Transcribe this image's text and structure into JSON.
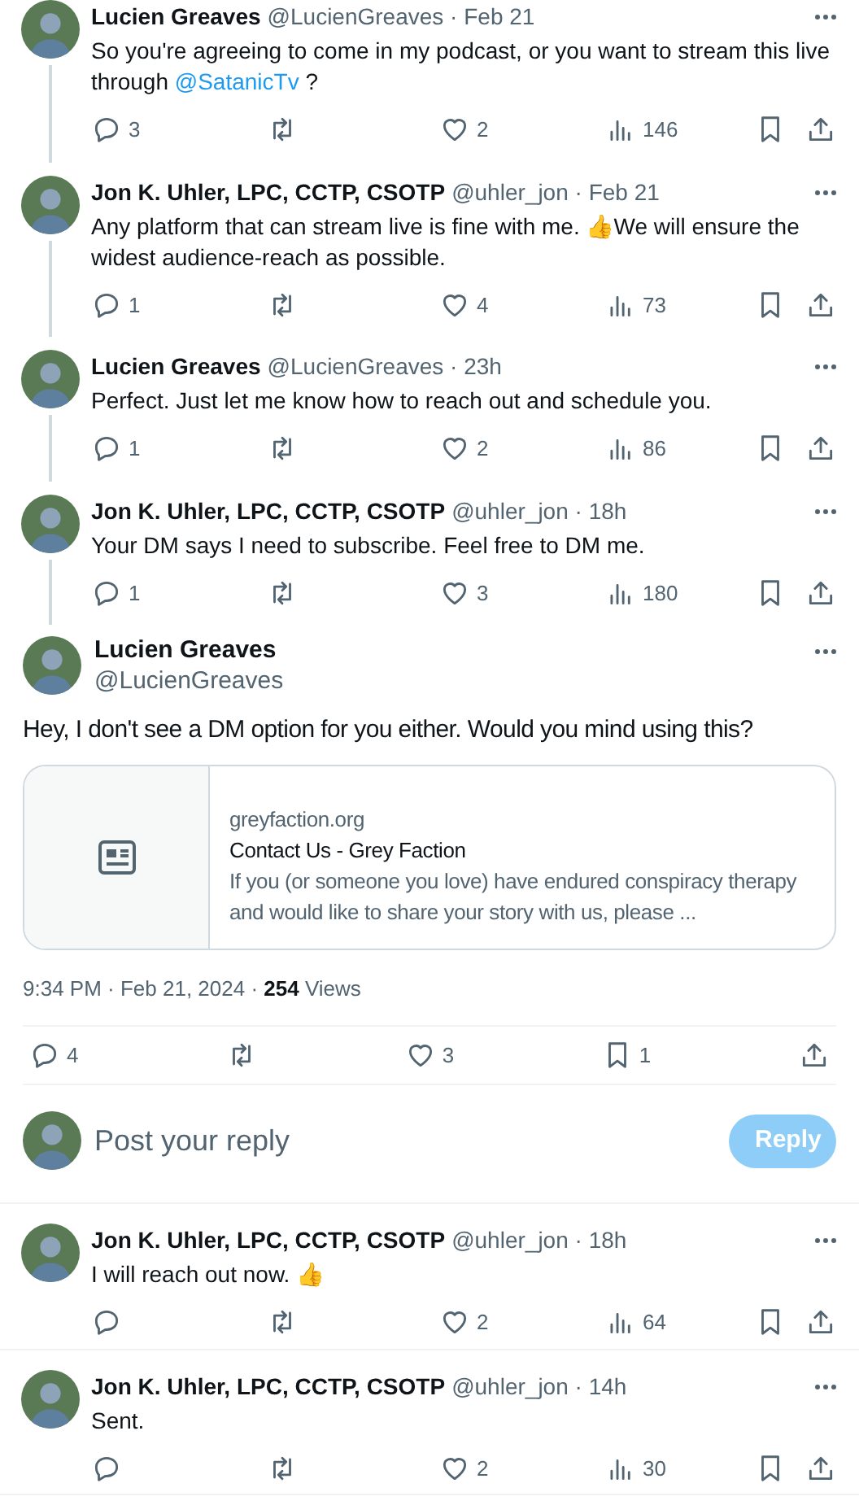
{
  "thread": [
    {
      "author": "Lucien Greaves",
      "handle": "@LucienGreaves · Feb 21",
      "segments": [
        {
          "kind": "plain",
          "text": "So you're agreeing to come in my podcast, or you want to stream this live through "
        },
        {
          "kind": "link",
          "text": "@SatanicTv"
        },
        {
          "kind": "plain",
          "text": " ?"
        }
      ],
      "replies": "3",
      "likes": "2",
      "views": "146"
    },
    {
      "author": "Jon K. Uhler, LPC, CCTP, CSOTP",
      "handle": "@uhler_jon · Feb 21",
      "segments": [
        {
          "kind": "plain",
          "text": "Any platform that can stream live is fine with me. 👍We will ensure the widest audience-reach as possible."
        }
      ],
      "replies": "1",
      "likes": "4",
      "views": "73"
    },
    {
      "author": "Lucien Greaves",
      "handle": "@LucienGreaves · 23h",
      "segments": [
        {
          "kind": "plain",
          "text": "Perfect. Just let me know how to reach out and schedule you."
        }
      ],
      "replies": "1",
      "likes": "2",
      "views": "86"
    },
    {
      "author": "Jon K. Uhler, LPC, CCTP, CSOTP",
      "handle": "@uhler_jon · 18h",
      "segments": [
        {
          "kind": "plain",
          "text": "Your DM says I need to subscribe. Feel free to DM me."
        }
      ],
      "replies": "1",
      "likes": "3",
      "views": "180"
    }
  ],
  "main_post": {
    "author": "Lucien Greaves",
    "handle": "@LucienGreaves",
    "text": "Hey, I don't see a DM option for you either. Would you mind using this?",
    "link_card": {
      "domain": "greyfaction.org",
      "title": "Contact Us - Grey Faction",
      "description": "If you (or someone you love) have endured conspiracy therapy and would like to share your story with us, please ..."
    },
    "meta": "9:34 PM · Feb 21, 2024 · **254** Views",
    "replies": "4",
    "likes": "3",
    "bookmarks": "1"
  },
  "composer": {
    "placeholder": "Post your reply",
    "button": "Reply",
    "disabled": true
  },
  "replies": [
    {
      "author": "Jon K. Uhler, LPC, CCTP, CSOTP",
      "handle": "@uhler_jon · 18h",
      "segments": [
        {
          "kind": "plain",
          "text": "I will reach out now. 👍"
        }
      ],
      "likes": "2",
      "views": "64"
    },
    {
      "author": "Jon K. Uhler, LPC, CCTP, CSOTP",
      "handle": "@uhler_jon · 14h",
      "segments": [
        {
          "kind": "plain",
          "text": "Sent."
        }
      ],
      "likes": "2",
      "views": "30"
    }
  ]
}
